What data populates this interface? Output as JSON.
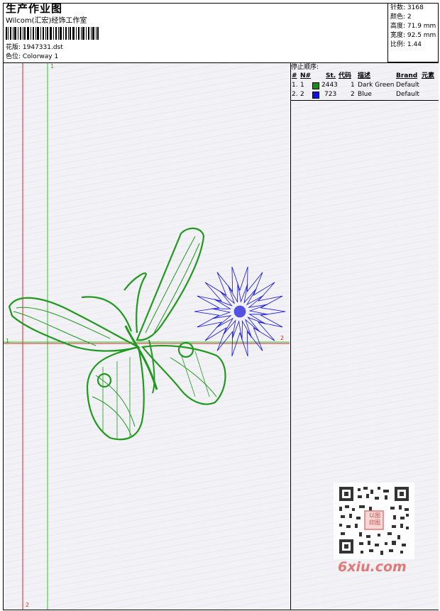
{
  "header": {
    "title": "生产作业图",
    "studio": "Wilcom(汇宏)经饰工作室",
    "design_label": "花版: 1947331.dst",
    "colorway_label": "色位: Colorway 1"
  },
  "stats": {
    "stitches": "针数: 3168",
    "colors": "颜色: 2",
    "height": "高度: 71.9 mm",
    "width": "宽度: 92.5 mm",
    "scale": "比例: 1.44"
  },
  "stop_sequence": {
    "title": "停止顺序:",
    "headers": [
      "#",
      "N#",
      "St.",
      "代码",
      "描述",
      "Brand",
      "元素"
    ],
    "rows": [
      {
        "index": "1.",
        "needle": "1",
        "color": "#1a8a1a",
        "stitches": "2443",
        "code": "1",
        "description": "Dark Green",
        "brand": "Default"
      },
      {
        "index": "2.",
        "needle": "2",
        "color": "#1010e0",
        "stitches": "723",
        "code": "2",
        "description": "Blue",
        "brand": "Default"
      }
    ]
  },
  "markers": {
    "green_top": "1",
    "green_left": "1",
    "red_right": "2",
    "red_bottom": "2"
  },
  "watermark": {
    "logo": "6xiu.com",
    "seal": "以图印图"
  }
}
